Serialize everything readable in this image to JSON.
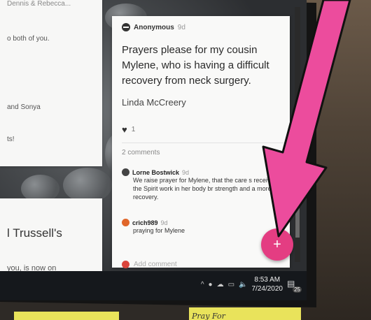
{
  "left_cards": {
    "top_snippet": "Dennis & Rebecca...",
    "line1": "o both of you.",
    "line2": "and Sonya",
    "line3": "ts!",
    "card2_title": "l Trussell's",
    "card2_snippet": "you, is now on"
  },
  "post": {
    "author": "Anonymous",
    "time": "9d",
    "body": "Prayers please for my cousin Mylene, who is having a difficult recovery from neck surgery.",
    "signature": "Linda McCreery",
    "likes": "1",
    "comments_count": "2 comments",
    "comments": [
      {
        "author": "Lorne Bostwick",
        "time": "9d",
        "text": "We raise prayer for Mylene, that the care s receives and the Spirit work in her body br strength and a more swift recovery."
      },
      {
        "author": "crich989",
        "time": "9d",
        "text": "praying for Mylene"
      }
    ],
    "add_comment_placeholder": "Add comment"
  },
  "fab": {
    "label": "+"
  },
  "taskbar": {
    "time": "8:53 AM",
    "date": "7/24/2020",
    "notification_count": "25",
    "chevron_icon": "^",
    "icons": [
      "onedrive-icon",
      "cloud-icon",
      "network-icon",
      "volume-icon"
    ]
  },
  "sticky_note": {
    "text": "Pray For"
  },
  "colors": {
    "accent": "#e43d82",
    "arrow": "#ec4c9d"
  }
}
